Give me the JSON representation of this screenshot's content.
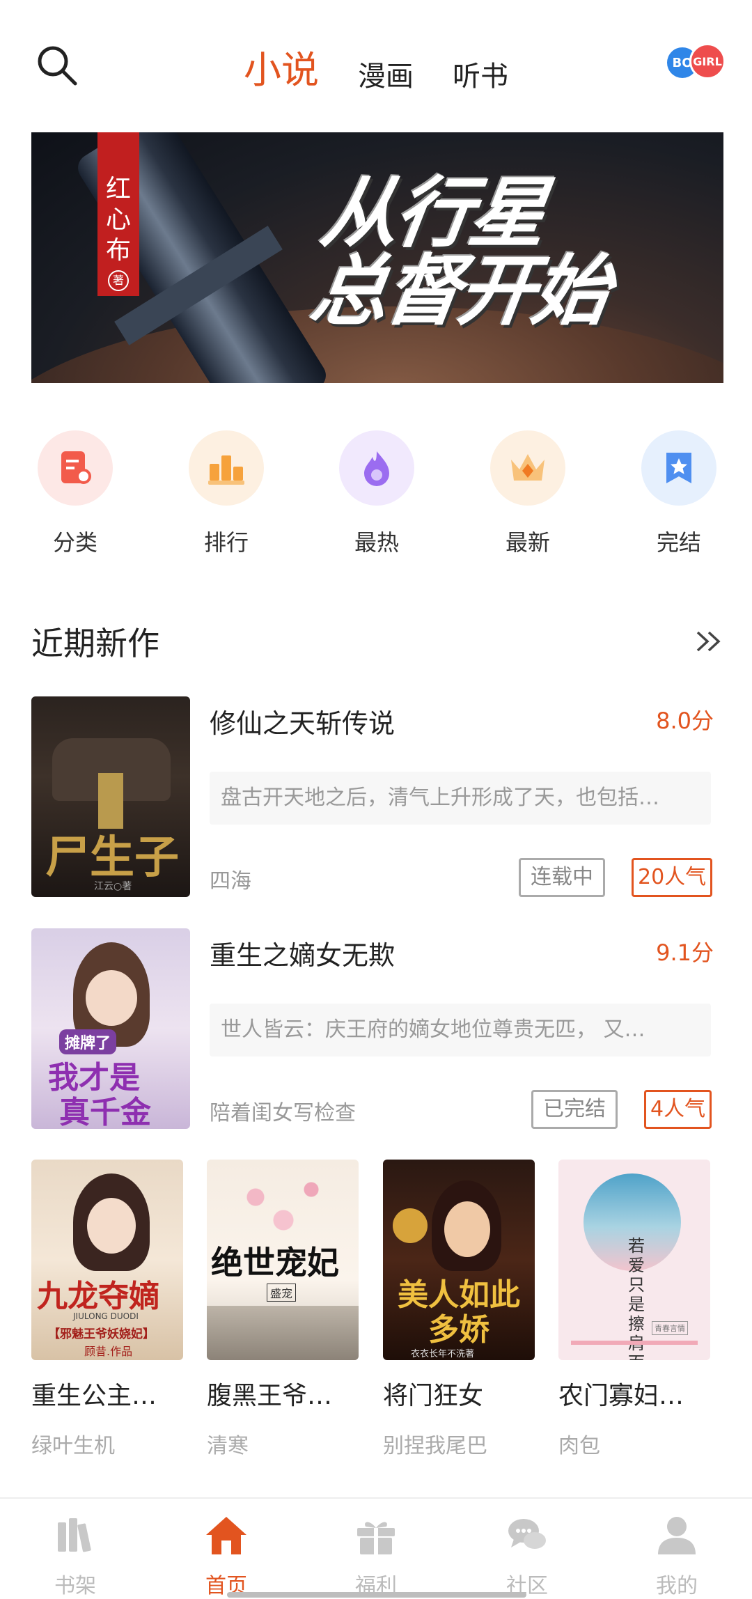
{
  "header": {
    "tabs": [
      {
        "label": "小说",
        "active": true
      },
      {
        "label": "漫画",
        "active": false
      },
      {
        "label": "听书",
        "active": false
      }
    ],
    "bo_label": "BO",
    "girl_label": "GIRL"
  },
  "banner": {
    "title_line1": "从行星",
    "title_line2": "总督开始",
    "author_chars": [
      "红",
      "心",
      "布"
    ],
    "author_mark": "著"
  },
  "categories": [
    {
      "label": "分类",
      "icon": "category-icon",
      "color": "#f25b4b"
    },
    {
      "label": "排行",
      "icon": "ranking-icon",
      "color": "#f6a23c"
    },
    {
      "label": "最热",
      "icon": "flame-icon",
      "color": "#9b6cf0"
    },
    {
      "label": "最新",
      "icon": "crown-icon",
      "color": "#f5a03a"
    },
    {
      "label": "完结",
      "icon": "star-badge-icon",
      "color": "#4f8ff0"
    }
  ],
  "section": {
    "title": "近期新作"
  },
  "books": [
    {
      "title": "修仙之天斩传说",
      "score": "8.0分",
      "desc": "盘古开天地之后，清气上升形成了天，也包括…",
      "author": "四海",
      "status": "连载中",
      "popularity": "20人气",
      "cover_text": "尸生子",
      "cover_small": "江云○著"
    },
    {
      "title": "重生之嫡女无欺",
      "score": "9.1分",
      "desc": "世人皆云：庆王府的嫡女地位尊贵无匹， 又…",
      "author": "陪着闺女写检查",
      "status": "已完结",
      "popularity": "4人气",
      "cover_text_line1": "摊牌了",
      "cover_text_line2": "我才是",
      "cover_text_line3": "真千金"
    }
  ],
  "grid": [
    {
      "title": "重生公主…",
      "author": "绿叶生机",
      "cover_text": "九龙夺嫡",
      "cover_sub": "JIULONG DUODI",
      "cover_sub2": "【邪魅王爷妖娆妃】",
      "cover_sub3": "顾昔.作品"
    },
    {
      "title": "腹黑王爷…",
      "author": "清寒",
      "cover_text": "绝世宠妃",
      "cover_sub": "盛宠"
    },
    {
      "title": "将门狂女",
      "author": "别捏我尾巴",
      "cover_text": "美人如此多娇",
      "cover_sub": "衣衣长年不洗著"
    },
    {
      "title": "农门寡妇…",
      "author": "肉包",
      "cover_text": "若爱只是擦肩而过",
      "cover_sub": "青春言情"
    }
  ],
  "bottom_nav": [
    {
      "label": "书架",
      "icon": "bookshelf-icon",
      "active": false
    },
    {
      "label": "首页",
      "icon": "home-icon",
      "active": true
    },
    {
      "label": "福利",
      "icon": "gift-icon",
      "active": false
    },
    {
      "label": "社区",
      "icon": "chat-icon",
      "active": false
    },
    {
      "label": "我的",
      "icon": "profile-icon",
      "active": false
    }
  ],
  "colors": {
    "accent": "#e2541f",
    "inactive": "#bbbbbb"
  }
}
